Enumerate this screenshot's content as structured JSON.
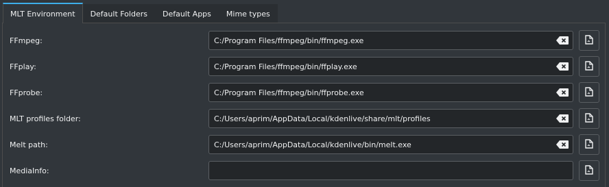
{
  "tabs": [
    {
      "label": "MLT Environment",
      "active": true
    },
    {
      "label": "Default Folders",
      "active": false
    },
    {
      "label": "Default Apps",
      "active": false
    },
    {
      "label": "Mime types",
      "active": false
    }
  ],
  "rows": [
    {
      "label": "FFmpeg:",
      "value": "C:/Program Files/ffmpeg/bin/ffmpeg.exe"
    },
    {
      "label": "FFplay:",
      "value": "C:/Program Files/ffmpeg/bin/ffplay.exe"
    },
    {
      "label": "FFprobe:",
      "value": "C:/Program Files/ffmpeg/bin/ffprobe.exe"
    },
    {
      "label": "MLT profiles folder:",
      "value": "C:/Users/aprim/AppData/Local/kdenlive/share/mlt/profiles"
    },
    {
      "label": "Melt path:",
      "value": "C:/Users/aprim/AppData/Local/kdenlive/bin/melt.exe"
    },
    {
      "label": "MediaInfo:",
      "value": ""
    }
  ],
  "icons": {
    "clear": "clear-text-icon",
    "browse": "open-file-icon"
  },
  "colors": {
    "accent": "#3daee9",
    "background": "#31363b",
    "field": "#232629"
  }
}
